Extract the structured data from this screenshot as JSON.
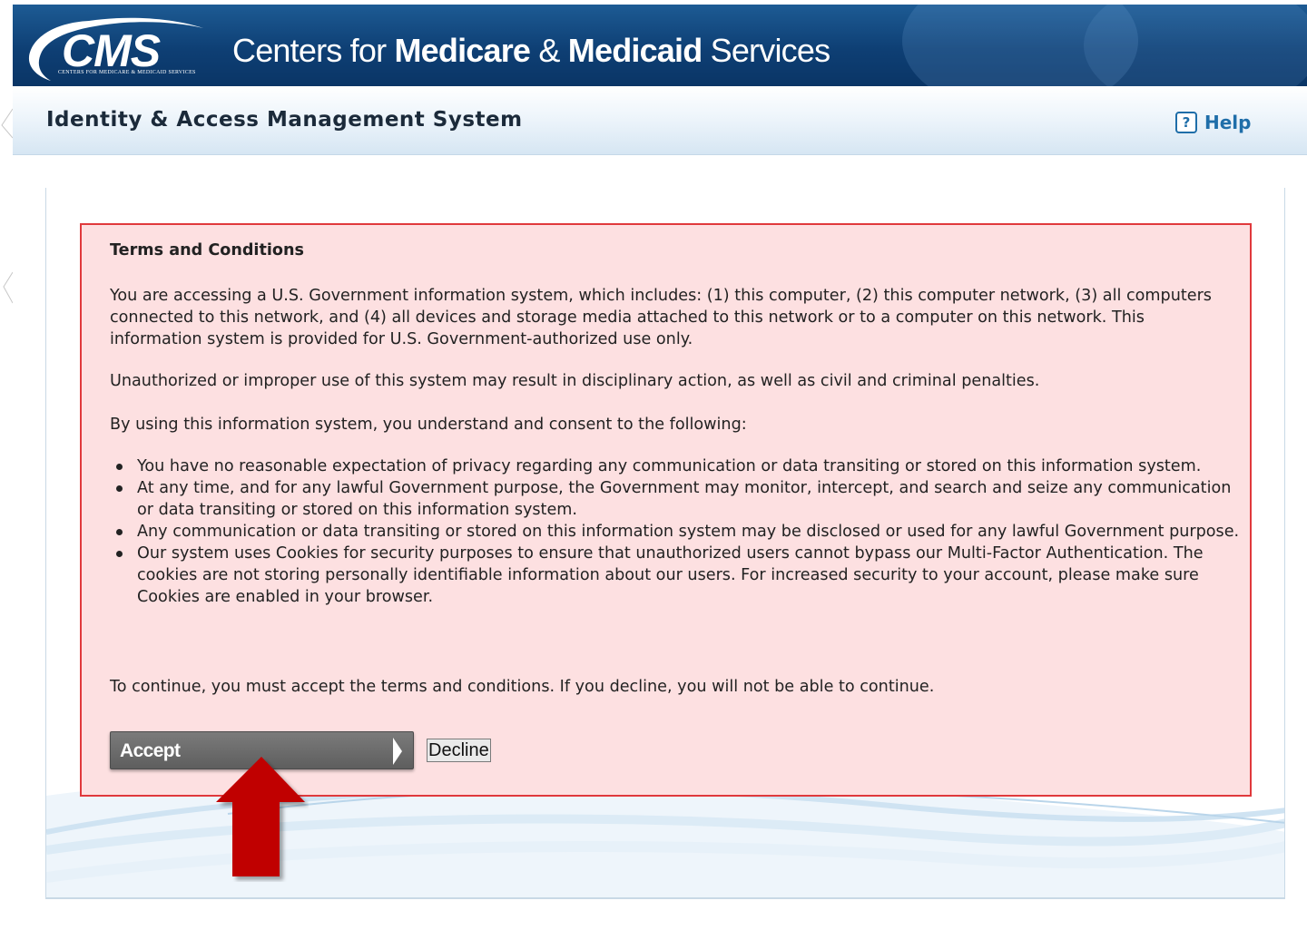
{
  "header": {
    "logo_text": "CMS",
    "logo_subtext": "CENTERS FOR MEDICARE & MEDICAID SERVICES",
    "org_name_prefix": "Centers for ",
    "org_name_bold1": "Medicare",
    "org_name_mid": " & ",
    "org_name_bold2": "Medicaid",
    "org_name_suffix": " Services"
  },
  "titlebar": {
    "app_title": "Identity & Access Management System",
    "help_icon_glyph": "?",
    "help_label": "Help"
  },
  "terms": {
    "heading": "Terms and Conditions",
    "paragraph1": "You are accessing a U.S. Government information system, which includes: (1) this computer, (2) this computer network, (3) all computers connected to this network, and (4) all devices and storage media attached to this network or to a computer on this network. This information system is provided for U.S. Government-authorized use only.",
    "paragraph2": "Unauthorized or improper use of this system may result in disciplinary action, as well as civil and criminal penalties.",
    "paragraph3": "By using this information system, you understand and consent to the following:",
    "bullets": [
      "You have no reasonable expectation of privacy regarding any communication or data transiting or stored on this information system.",
      "At any time, and for any lawful Government purpose, the Government may monitor, intercept, and search and seize any communication or data transiting or stored on this information system.",
      "Any communication or data transiting or stored on this information system may be disclosed or used for any lawful Government purpose.",
      "Our system uses Cookies for security purposes to ensure that unauthorized users cannot bypass our Multi-Factor Authentication. The cookies are not storing personally identifiable information about our users. For increased security to your account, please make sure Cookies are enabled in your browser."
    ],
    "paragraph4": "To continue, you must accept the terms and conditions. If you decline, you will not be able to continue.",
    "accept_label": "Accept",
    "decline_label": "Decline"
  },
  "colors": {
    "banner": "#0e3f74",
    "terms_background": "#fde0e1",
    "terms_border": "#e0393c",
    "help_link": "#1f6ea9",
    "accept_button": "#6b6b6b",
    "annotation_arrow": "#c00000"
  },
  "icons": {
    "help": "question-box-icon",
    "accept_arrow": "chevron-right-icon",
    "annotation": "red-up-arrow-icon"
  }
}
